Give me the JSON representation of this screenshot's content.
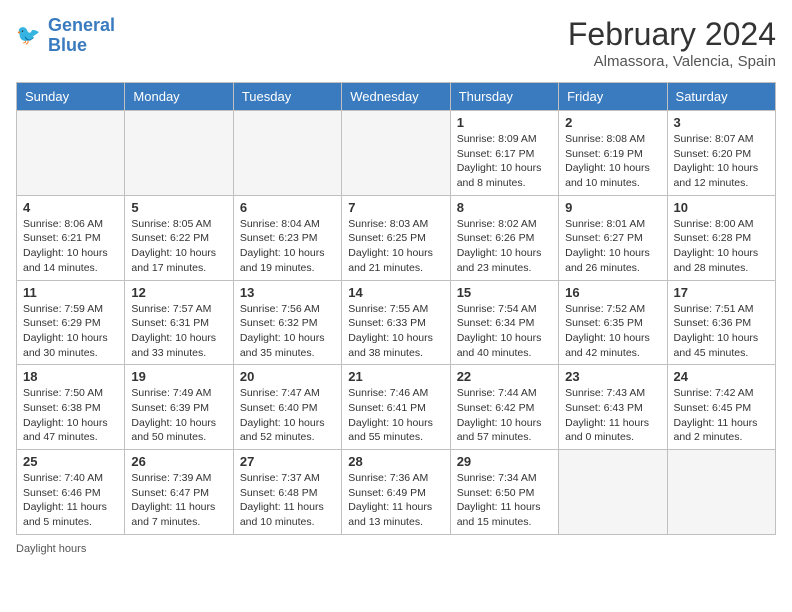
{
  "logo": {
    "line1": "General",
    "line2": "Blue"
  },
  "title": "February 2024",
  "subtitle": "Almassora, Valencia, Spain",
  "days_of_week": [
    "Sunday",
    "Monday",
    "Tuesday",
    "Wednesday",
    "Thursday",
    "Friday",
    "Saturday"
  ],
  "weeks": [
    [
      {
        "day": "",
        "info": ""
      },
      {
        "day": "",
        "info": ""
      },
      {
        "day": "",
        "info": ""
      },
      {
        "day": "",
        "info": ""
      },
      {
        "day": "1",
        "info": "Sunrise: 8:09 AM\nSunset: 6:17 PM\nDaylight: 10 hours\nand 8 minutes."
      },
      {
        "day": "2",
        "info": "Sunrise: 8:08 AM\nSunset: 6:19 PM\nDaylight: 10 hours\nand 10 minutes."
      },
      {
        "day": "3",
        "info": "Sunrise: 8:07 AM\nSunset: 6:20 PM\nDaylight: 10 hours\nand 12 minutes."
      }
    ],
    [
      {
        "day": "4",
        "info": "Sunrise: 8:06 AM\nSunset: 6:21 PM\nDaylight: 10 hours\nand 14 minutes."
      },
      {
        "day": "5",
        "info": "Sunrise: 8:05 AM\nSunset: 6:22 PM\nDaylight: 10 hours\nand 17 minutes."
      },
      {
        "day": "6",
        "info": "Sunrise: 8:04 AM\nSunset: 6:23 PM\nDaylight: 10 hours\nand 19 minutes."
      },
      {
        "day": "7",
        "info": "Sunrise: 8:03 AM\nSunset: 6:25 PM\nDaylight: 10 hours\nand 21 minutes."
      },
      {
        "day": "8",
        "info": "Sunrise: 8:02 AM\nSunset: 6:26 PM\nDaylight: 10 hours\nand 23 minutes."
      },
      {
        "day": "9",
        "info": "Sunrise: 8:01 AM\nSunset: 6:27 PM\nDaylight: 10 hours\nand 26 minutes."
      },
      {
        "day": "10",
        "info": "Sunrise: 8:00 AM\nSunset: 6:28 PM\nDaylight: 10 hours\nand 28 minutes."
      }
    ],
    [
      {
        "day": "11",
        "info": "Sunrise: 7:59 AM\nSunset: 6:29 PM\nDaylight: 10 hours\nand 30 minutes."
      },
      {
        "day": "12",
        "info": "Sunrise: 7:57 AM\nSunset: 6:31 PM\nDaylight: 10 hours\nand 33 minutes."
      },
      {
        "day": "13",
        "info": "Sunrise: 7:56 AM\nSunset: 6:32 PM\nDaylight: 10 hours\nand 35 minutes."
      },
      {
        "day": "14",
        "info": "Sunrise: 7:55 AM\nSunset: 6:33 PM\nDaylight: 10 hours\nand 38 minutes."
      },
      {
        "day": "15",
        "info": "Sunrise: 7:54 AM\nSunset: 6:34 PM\nDaylight: 10 hours\nand 40 minutes."
      },
      {
        "day": "16",
        "info": "Sunrise: 7:52 AM\nSunset: 6:35 PM\nDaylight: 10 hours\nand 42 minutes."
      },
      {
        "day": "17",
        "info": "Sunrise: 7:51 AM\nSunset: 6:36 PM\nDaylight: 10 hours\nand 45 minutes."
      }
    ],
    [
      {
        "day": "18",
        "info": "Sunrise: 7:50 AM\nSunset: 6:38 PM\nDaylight: 10 hours\nand 47 minutes."
      },
      {
        "day": "19",
        "info": "Sunrise: 7:49 AM\nSunset: 6:39 PM\nDaylight: 10 hours\nand 50 minutes."
      },
      {
        "day": "20",
        "info": "Sunrise: 7:47 AM\nSunset: 6:40 PM\nDaylight: 10 hours\nand 52 minutes."
      },
      {
        "day": "21",
        "info": "Sunrise: 7:46 AM\nSunset: 6:41 PM\nDaylight: 10 hours\nand 55 minutes."
      },
      {
        "day": "22",
        "info": "Sunrise: 7:44 AM\nSunset: 6:42 PM\nDaylight: 10 hours\nand 57 minutes."
      },
      {
        "day": "23",
        "info": "Sunrise: 7:43 AM\nSunset: 6:43 PM\nDaylight: 11 hours\nand 0 minutes."
      },
      {
        "day": "24",
        "info": "Sunrise: 7:42 AM\nSunset: 6:45 PM\nDaylight: 11 hours\nand 2 minutes."
      }
    ],
    [
      {
        "day": "25",
        "info": "Sunrise: 7:40 AM\nSunset: 6:46 PM\nDaylight: 11 hours\nand 5 minutes."
      },
      {
        "day": "26",
        "info": "Sunrise: 7:39 AM\nSunset: 6:47 PM\nDaylight: 11 hours\nand 7 minutes."
      },
      {
        "day": "27",
        "info": "Sunrise: 7:37 AM\nSunset: 6:48 PM\nDaylight: 11 hours\nand 10 minutes."
      },
      {
        "day": "28",
        "info": "Sunrise: 7:36 AM\nSunset: 6:49 PM\nDaylight: 11 hours\nand 13 minutes."
      },
      {
        "day": "29",
        "info": "Sunrise: 7:34 AM\nSunset: 6:50 PM\nDaylight: 11 hours\nand 15 minutes."
      },
      {
        "day": "",
        "info": ""
      },
      {
        "day": "",
        "info": ""
      }
    ]
  ],
  "footer": "Daylight hours"
}
